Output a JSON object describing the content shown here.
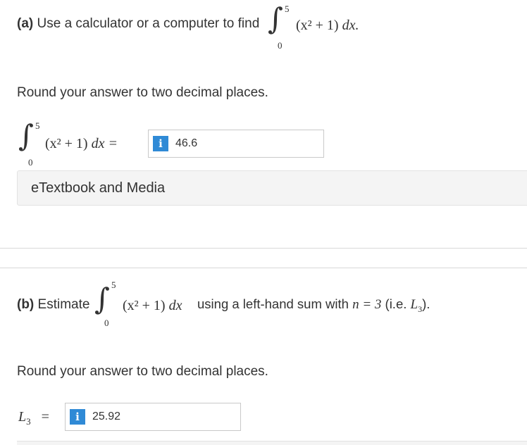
{
  "part_a": {
    "prompt_prefix": "(a)",
    "prompt_text": "Use a calculator or a computer to find",
    "integral": {
      "upper": "5",
      "lower": "0",
      "integrand": "(x² + 1)",
      "dx": "dx."
    },
    "round_text": "Round your answer to two decimal places.",
    "answer_integral": {
      "upper": "5",
      "lower": "0",
      "integrand": "(x² + 1)",
      "dx": "dx ="
    },
    "answer_value": "46.6",
    "info_glyph": "i"
  },
  "etextbook_label": "eTextbook and Media",
  "part_b": {
    "prompt_prefix": "(b)",
    "prompt_text": "Estimate",
    "integral": {
      "upper": "5",
      "lower": "0",
      "integrand": "(x² + 1)",
      "dx": "dx"
    },
    "prompt_suffix": "using a left-hand sum with",
    "n_expr": "n = 3",
    "paren_text": "(i.e. ",
    "l3": "L",
    "l3_sub": "3",
    "paren_close": ").",
    "round_text": "Round your answer to two decimal places.",
    "answer_label": "L",
    "answer_label_sub": "3",
    "answer_eq": "=",
    "answer_value": "25.92",
    "info_glyph": "i"
  },
  "colors": {
    "info_badge": "#2f8ad6",
    "panel_bg": "#f4f4f4"
  }
}
